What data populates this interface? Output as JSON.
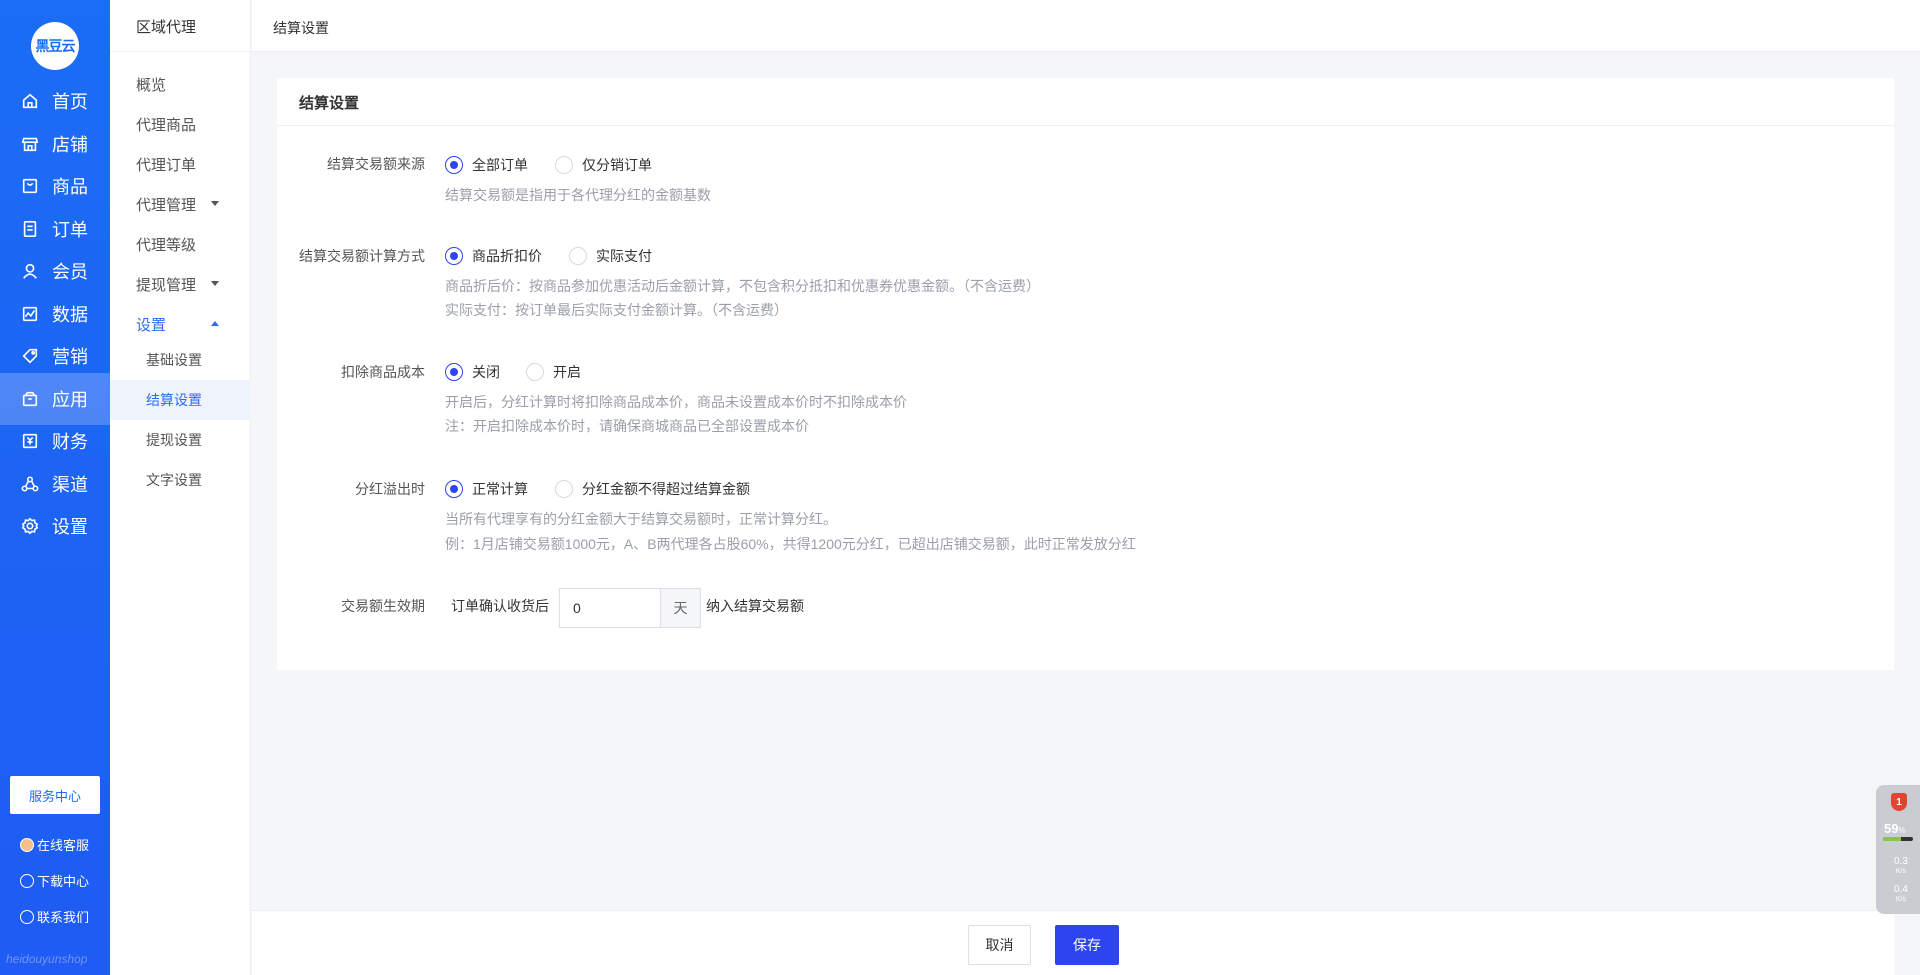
{
  "brand": {
    "logo_text": "黑豆云",
    "watermark": "heidouyunshop"
  },
  "main_nav": [
    {
      "label": "首页",
      "icon": "home-icon"
    },
    {
      "label": "店铺",
      "icon": "store-icon"
    },
    {
      "label": "商品",
      "icon": "goods-icon"
    },
    {
      "label": "订单",
      "icon": "order-icon"
    },
    {
      "label": "会员",
      "icon": "member-icon"
    },
    {
      "label": "数据",
      "icon": "chart-icon"
    },
    {
      "label": "营销",
      "icon": "tag-icon"
    },
    {
      "label": "应用",
      "icon": "app-box-icon"
    },
    {
      "label": "财务",
      "icon": "finance-icon"
    },
    {
      "label": "渠道",
      "icon": "channel-icon"
    },
    {
      "label": "设置",
      "icon": "gear-icon"
    }
  ],
  "footer": {
    "service_center": "服务中心",
    "online_service": "在线客服",
    "download_center": "下载中心",
    "contact_us": "联系我们"
  },
  "sub_nav": {
    "title": "区域代理",
    "items": [
      "概览",
      "代理商品",
      "代理订单",
      "代理管理",
      "代理等级",
      "提现管理",
      "设置"
    ],
    "settings_children": [
      "基础设置",
      "结算设置",
      "提现设置",
      "文字设置"
    ]
  },
  "header": {
    "breadcrumb": "结算设置"
  },
  "card": {
    "title": "结算设置",
    "fields": {
      "source": {
        "label": "结算交易额来源",
        "options": [
          "全部订单",
          "仅分销订单"
        ],
        "selected": "全部订单",
        "hints": [
          "结算交易额是指用于各代理分红的金额基数"
        ]
      },
      "calc": {
        "label": "结算交易额计算方式",
        "options": [
          "商品折扣价",
          "实际支付"
        ],
        "selected": "商品折扣价",
        "hints": [
          "商品折后价：按商品参加优惠活动后金额计算，不包含积分抵扣和优惠券优惠金额。（不含运费）",
          "实际支付：按订单最后实际支付金额计算。（不含运费）"
        ]
      },
      "cost": {
        "label": "扣除商品成本",
        "options": [
          "关闭",
          "开启"
        ],
        "selected": "关闭",
        "hints": [
          "开启后，分红计算时将扣除商品成本价，商品未设置成本价时不扣除成本价",
          "注：开启扣除成本价时，请确保商城商品已全部设置成本价"
        ]
      },
      "overflow": {
        "label": "分红溢出时",
        "options": [
          "正常计算",
          "分红金额不得超过结算金额"
        ],
        "selected": "正常计算",
        "hints": [
          "当所有代理享有的分红金额大于结算交易额时，正常计算分红。",
          "例：1月店铺交易额1000元，A、B两代理各占股60%，共得1200元分红，已超出店铺交易额，此时正常发放分红"
        ]
      },
      "effective": {
        "label": "交易额生效期",
        "prefix": "订单确认收货后",
        "value": "0",
        "unit": "天",
        "suffix": "纳入结算交易额"
      }
    }
  },
  "actions": {
    "cancel": "取消",
    "save": "保存"
  },
  "widget": {
    "badge": "1",
    "percent": "59",
    "percent_unit": "%",
    "up": "0.3",
    "down": "0.4",
    "speed_unit": "K/s",
    "usage": 0.59
  }
}
